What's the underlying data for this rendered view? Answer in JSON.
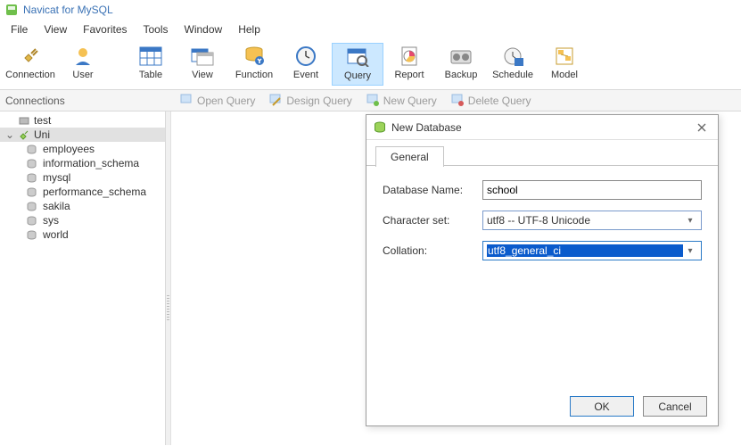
{
  "app": {
    "title": "Navicat for MySQL"
  },
  "menu": [
    "File",
    "View",
    "Favorites",
    "Tools",
    "Window",
    "Help"
  ],
  "toolbar": {
    "connection": "Connection",
    "user": "User",
    "table": "Table",
    "view": "View",
    "function": "Function",
    "event": "Event",
    "query": "Query",
    "report": "Report",
    "backup": "Backup",
    "schedule": "Schedule",
    "model": "Model"
  },
  "subbar": {
    "panel_title": "Connections",
    "open_query": "Open Query",
    "design_query": "Design Query",
    "new_query": "New Query",
    "delete_query": "Delete Query"
  },
  "tree": {
    "root1": "test",
    "root2": "Uni",
    "children": [
      "employees",
      "information_schema",
      "mysql",
      "performance_schema",
      "sakila",
      "sys",
      "world"
    ]
  },
  "dialog": {
    "title": "New Database",
    "tab_general": "General",
    "label_dbname": "Database Name:",
    "value_dbname": "school",
    "label_charset": "Character set:",
    "value_charset": "utf8 -- UTF-8 Unicode",
    "label_collation": "Collation:",
    "value_collation": "utf8_general_ci",
    "ok": "OK",
    "cancel": "Cancel"
  }
}
